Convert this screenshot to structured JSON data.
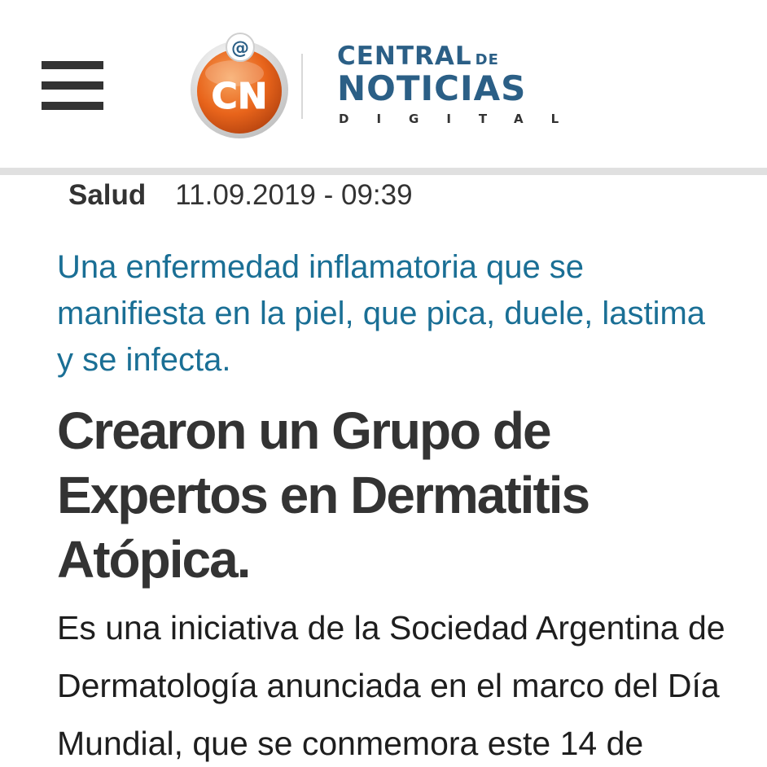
{
  "header": {
    "menu_icon": "hamburger-menu-icon",
    "logo": {
      "mark_text": "CN",
      "line1": "CENTRAL",
      "line1_small": "DE",
      "line2": "NOTICIAS",
      "line3": "DIGITAL",
      "colors": {
        "orange": "#e8641b",
        "blue": "#2b5f86"
      }
    }
  },
  "article": {
    "category": "Salud",
    "datetime": "11.09.2019 - 09:39",
    "dek_lines": [
      "Una enfermedad inflamatoria que se",
      "manifiesta en la piel, que pica, duele, lastima",
      "y se infecta."
    ],
    "headline_lines": [
      "Crearon un Grupo de",
      "Expertos en Dermatitis",
      "Atópica."
    ],
    "body_lines": [
      "Es una iniciativa de la Sociedad Argentina de",
      "Dermatología anunciada en el marco del Día",
      "Mundial, que se conmemora este 14 de"
    ]
  },
  "colors": {
    "dek": "#1a6f95",
    "headline": "#333333",
    "body": "#1e1e1e",
    "rule": "#e0e0e0"
  }
}
